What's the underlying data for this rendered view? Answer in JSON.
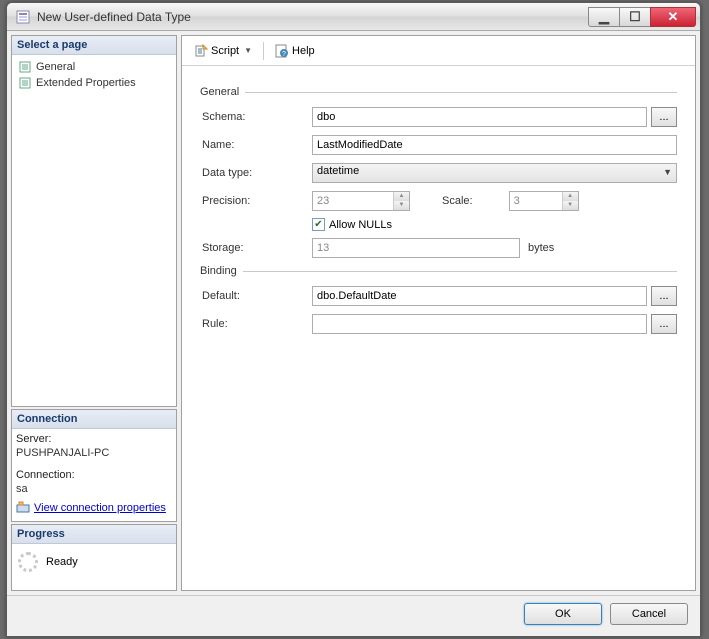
{
  "window": {
    "title": "New User-defined Data Type"
  },
  "leftPanel": {
    "selectPage": {
      "header": "Select a page",
      "items": [
        {
          "label": "General"
        },
        {
          "label": "Extended Properties"
        }
      ]
    },
    "connection": {
      "header": "Connection",
      "serverLabel": "Server:",
      "serverValue": "PUSHPANJALI-PC",
      "connectionLabel": "Connection:",
      "connectionValue": "sa",
      "viewPropsLink": "View connection properties"
    },
    "progress": {
      "header": "Progress",
      "status": "Ready"
    }
  },
  "toolbar": {
    "script": "Script",
    "help": "Help"
  },
  "form": {
    "generalGroup": "General",
    "schemaLabel": "Schema:",
    "schemaValue": "dbo",
    "nameLabel": "Name:",
    "nameValue": "LastModifiedDate",
    "dataTypeLabel": "Data type:",
    "dataTypeValue": "datetime",
    "precisionLabel": "Precision:",
    "precisionValue": "23",
    "scaleLabel": "Scale:",
    "scaleValue": "3",
    "allowNullsLabel": "Allow NULLs",
    "storageLabel": "Storage:",
    "storageValue": "13",
    "storageUnit": "bytes",
    "bindingGroup": "Binding",
    "defaultLabel": "Default:",
    "defaultValue": "dbo.DefaultDate",
    "ruleLabel": "Rule:",
    "ruleValue": ""
  },
  "footer": {
    "ok": "OK",
    "cancel": "Cancel"
  }
}
